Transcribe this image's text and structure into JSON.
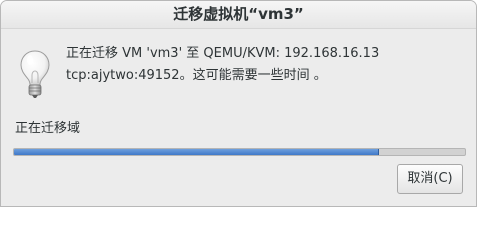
{
  "dialog": {
    "title": "迁移虚拟机“vm3”",
    "icon": "lightbulb-icon",
    "message_line1": "正在迁移 VM 'vm3' 至  QEMU/KVM: 192.168.16.13",
    "message_line2": "tcp:ajytwo:49152。这可能需要一些时间 。",
    "status": "正在迁移域",
    "progress": 0.81,
    "cancel_label": "取消(C)"
  },
  "colors": {
    "progress_fill": "#3f78c8",
    "window_bg": "#ececec"
  }
}
